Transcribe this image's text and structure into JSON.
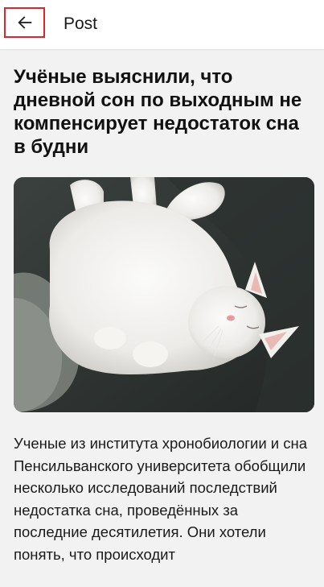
{
  "appbar": {
    "title": "Post",
    "back_icon": "arrow-left-icon",
    "highlight_color": "#e3222b"
  },
  "article": {
    "headline": "Учёные выяснили, что дневной сон по выходным не компенсирует недостаток сна в будни",
    "image_subject": "white cat sleeping on a dark grey couch",
    "body": "Ученые из института хронобиологии и сна Пенсильванского университета обобщили несколько исследований последствий недостатка сна, проведённых за последние десятилетия. Они хотели понять, что происходит"
  }
}
